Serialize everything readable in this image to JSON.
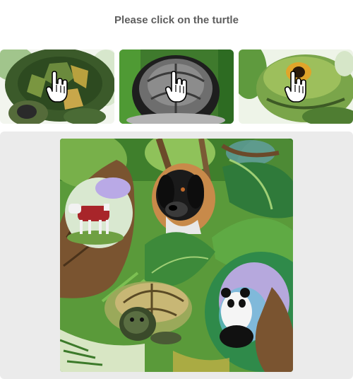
{
  "prompt": {
    "text": "Please click on the turtle"
  },
  "example_images": [
    {
      "icon": "turtle-shell-example-icon"
    },
    {
      "icon": "turtle-gray-shell-example-icon"
    },
    {
      "icon": "turtle-head-example-icon"
    }
  ],
  "cursor_icon": "pointer-hand-icon",
  "challenge_image": {
    "objects": [
      "tree-trunk",
      "cow",
      "dog",
      "leaves",
      "turtle",
      "panda"
    ]
  }
}
